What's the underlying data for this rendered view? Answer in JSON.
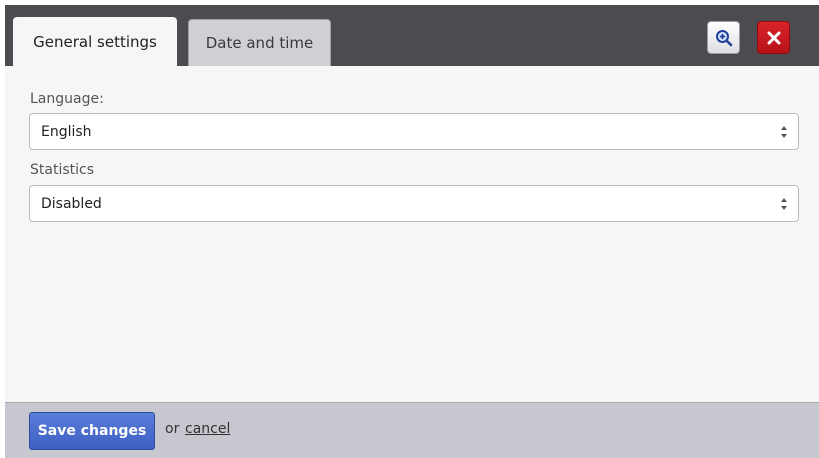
{
  "tabs": [
    {
      "label": "General settings",
      "active": true
    },
    {
      "label": "Date and time",
      "active": false
    }
  ],
  "header_buttons": {
    "zoom_icon": "zoom-in-icon",
    "close_icon": "close-icon"
  },
  "fields": {
    "language": {
      "label": "Language:",
      "value": "English"
    },
    "statistics": {
      "label": "Statistics",
      "value": "Disabled"
    }
  },
  "footer": {
    "save_label": "Save changes",
    "or_text": "or",
    "cancel_label": "cancel"
  },
  "colors": {
    "header_bg": "#4b4b50",
    "close_button": "#c81a20",
    "save_button": "#4a6ccf",
    "footer_bg": "#c7c8cf"
  }
}
